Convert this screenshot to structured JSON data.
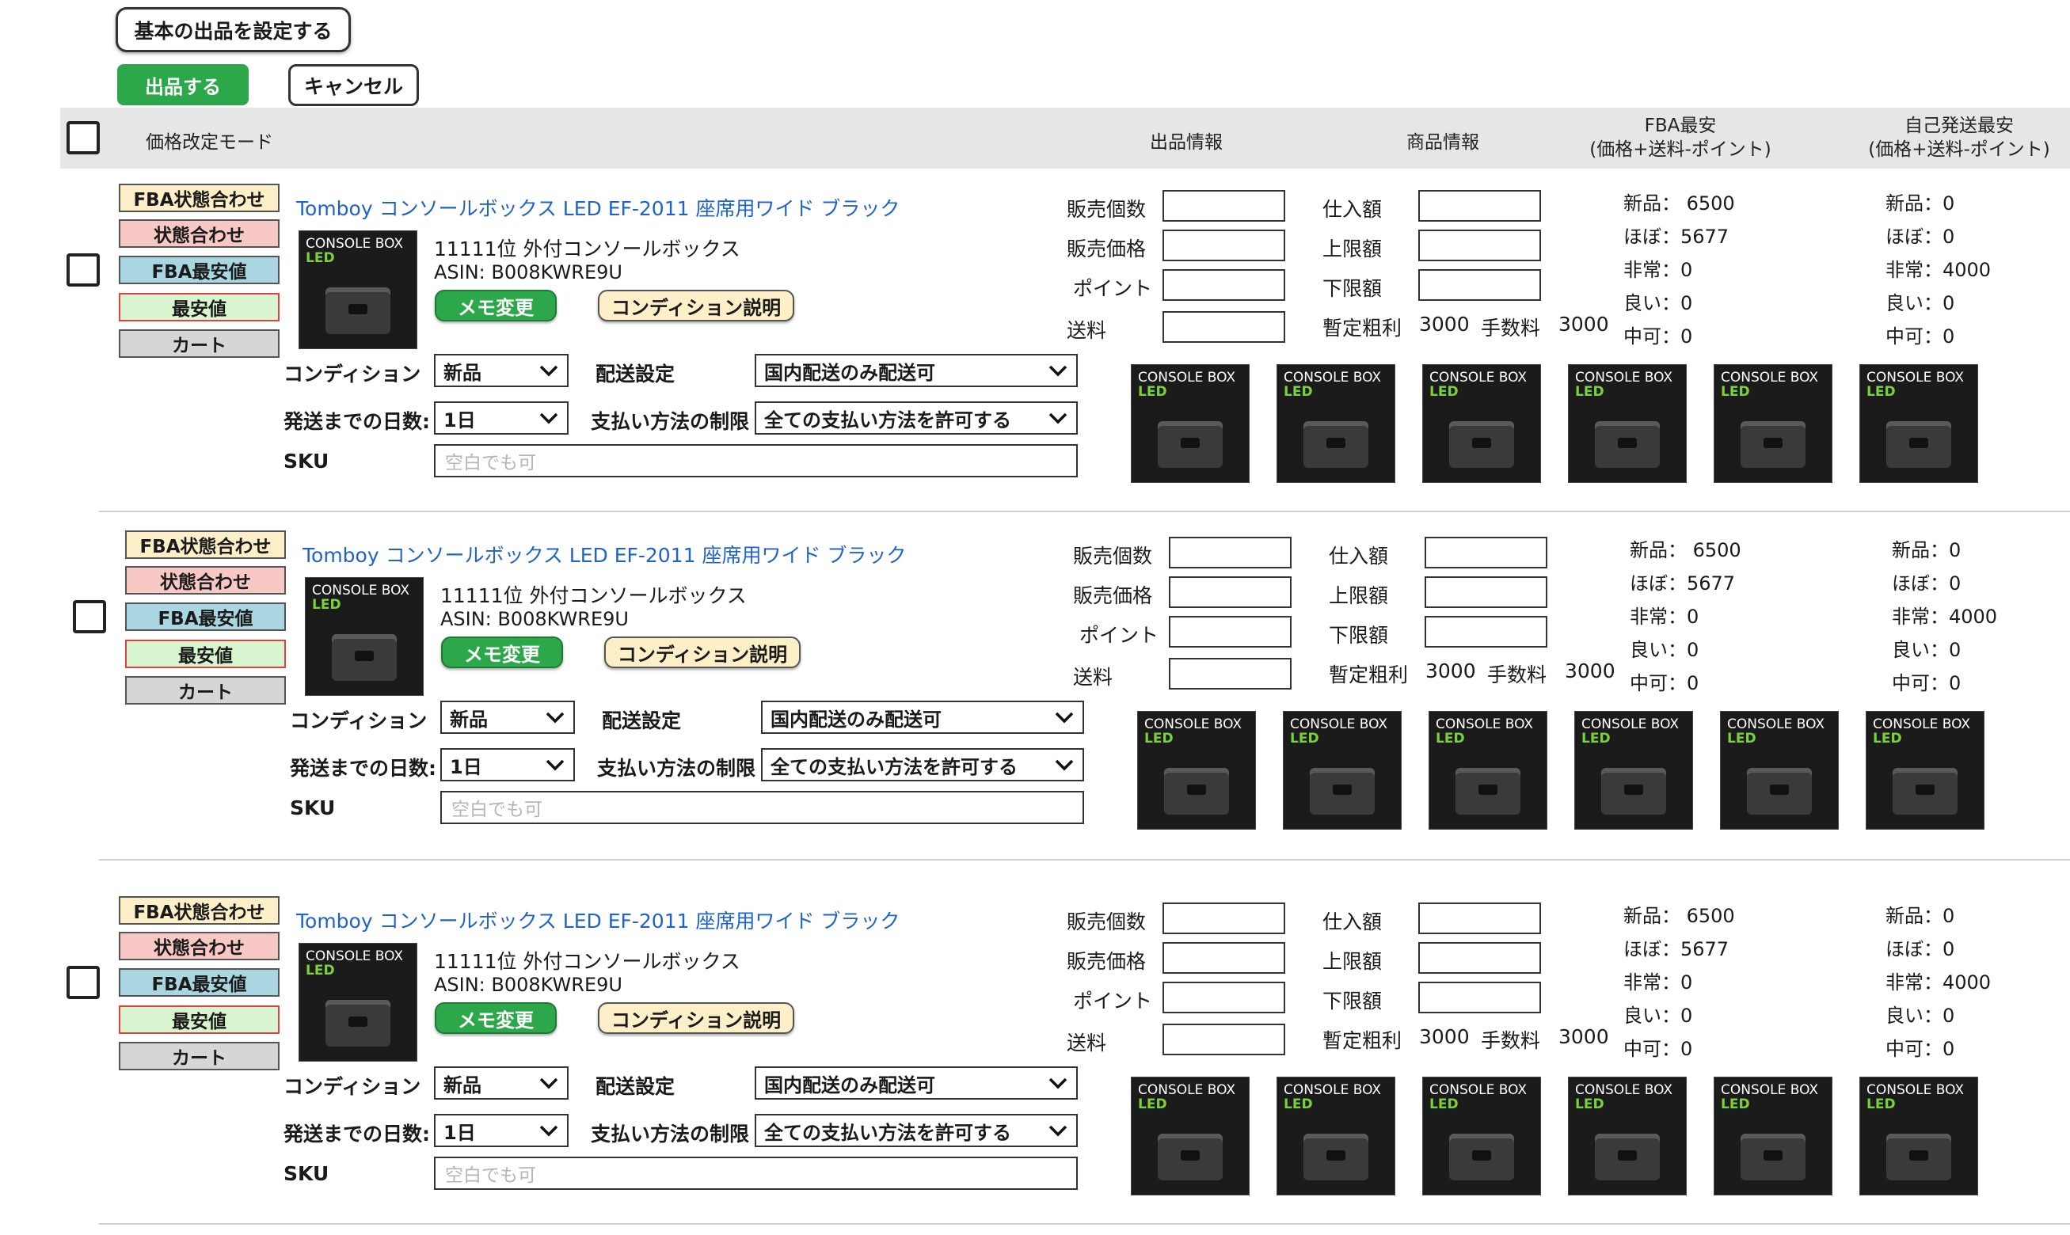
{
  "toolbar": {
    "basic_settings_label": "基本の出品を設定する",
    "list_label": "出品する",
    "cancel_label": "キャンセル"
  },
  "header": {
    "price_mode": "価格改定モード",
    "listing_info": "出品情報",
    "product_info": "商品情報",
    "fba_min_title": "FBA最安",
    "fba_min_sub": "(価格+送料-ポイント)",
    "self_min_title": "自己発送最安",
    "self_min_sub": "(価格+送料-ポイント)"
  },
  "mode_buttons": {
    "fba_condition": "FBA状態合わせ",
    "condition": "状態合わせ",
    "fba_min": "FBA最安値",
    "min": "最安値",
    "cart": "カート"
  },
  "form_labels": {
    "qty": "販売個数",
    "price": "販売価格",
    "point": "ポイント",
    "shipping": "送料",
    "cost": "仕入額",
    "upper": "上限額",
    "lower": "下限額",
    "gross_profit": "暫定粗利",
    "fee": "手数料",
    "condition": "コンディション",
    "delivery_setting": "配送設定",
    "days": "発送までの日数:",
    "payment": "支払い方法の制限",
    "sku": "SKU",
    "memo_button": "メモ変更",
    "condition_desc_button": "コンディション説明"
  },
  "thumbnail": {
    "line1": "CONSOLE BOX",
    "line2": "LED"
  },
  "rows": [
    {
      "title": "Tomboy コンソールボックス LED EF-2011 座席用ワイド ブラック",
      "rank": "11111位 外付コンソールボックス",
      "asin": "ASIN: B008KWRE9U",
      "gross_profit_value": "3000",
      "fee_value": "3000",
      "condition_value": "新品",
      "delivery_value": "国内配送のみ配送可",
      "days_value": "1日",
      "payment_value": "全ての支払い方法を許可する",
      "sku_placeholder": "空白でも可",
      "fba": [
        "新品： 6500",
        "ほぼ：5677",
        "非常：0",
        "良い：0",
        "中可：0"
      ],
      "self": [
        "新品：0",
        "ほぼ：0",
        "非常：4000",
        "良い：0",
        "中可：0"
      ]
    },
    {
      "title": "Tomboy コンソールボックス LED EF-2011 座席用ワイド ブラック",
      "rank": "11111位 外付コンソールボックス",
      "asin": "ASIN: B008KWRE9U",
      "gross_profit_value": "3000",
      "fee_value": "3000",
      "condition_value": "新品",
      "delivery_value": "国内配送のみ配送可",
      "days_value": "1日",
      "payment_value": "全ての支払い方法を許可する",
      "sku_placeholder": "空白でも可",
      "fba": [
        "新品： 6500",
        "ほぼ：5677",
        "非常：0",
        "良い：0",
        "中可：0"
      ],
      "self": [
        "新品：0",
        "ほぼ：0",
        "非常：4000",
        "良い：0",
        "中可：0"
      ]
    },
    {
      "title": "Tomboy コンソールボックス LED EF-2011 座席用ワイド ブラック",
      "rank": "11111位 外付コンソールボックス",
      "asin": "ASIN: B008KWRE9U",
      "gross_profit_value": "3000",
      "fee_value": "3000",
      "condition_value": "新品",
      "delivery_value": "国内配送のみ配送可",
      "days_value": "1日",
      "payment_value": "全ての支払い方法を許可する",
      "sku_placeholder": "空白でも可",
      "fba": [
        "新品： 6500",
        "ほぼ：5677",
        "非常：0",
        "良い：0",
        "中可：0"
      ],
      "self": [
        "新品：0",
        "ほぼ：0",
        "非常：4000",
        "良い：0",
        "中可：0"
      ]
    }
  ]
}
